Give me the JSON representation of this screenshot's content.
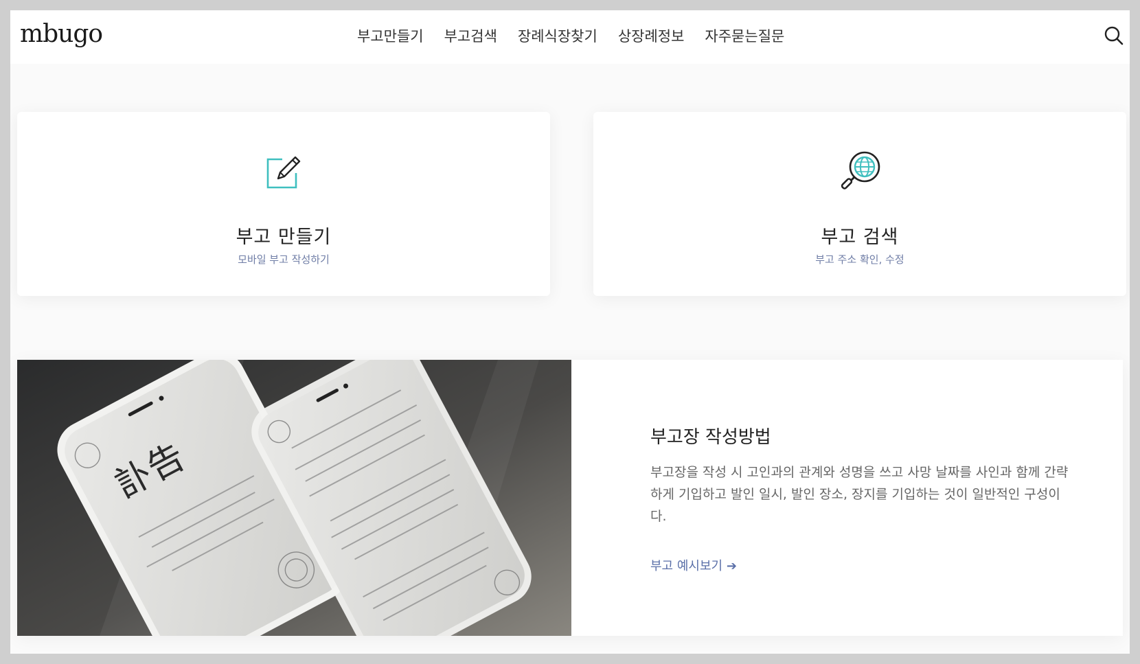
{
  "header": {
    "logo": "mbugo",
    "nav": [
      {
        "label": "부고만들기"
      },
      {
        "label": "부고검색"
      },
      {
        "label": "장례식장찾기"
      },
      {
        "label": "상장례정보"
      },
      {
        "label": "자주묻는질문"
      }
    ],
    "search_icon": "search-icon"
  },
  "cards": [
    {
      "title": "부고 만들기",
      "subtitle": "모바일 부고 작성하기",
      "icon": "edit-icon"
    },
    {
      "title": "부고 검색",
      "subtitle": "부고 주소 확인, 수정",
      "icon": "globe-search-icon"
    }
  ],
  "feature": {
    "title": "부고장 작성방법",
    "description": "부고장을 작성 시 고인과의 관계와 성명을 쓰고 사망 날짜를 사인과 함께 간략하게 기입하고 발인 일시, 발인 장소, 장지를 기입하는 것이 일반적인 구성이다.",
    "link_label": "부고 예시보기",
    "link_arrow": "➔",
    "phone_heading": "訃告"
  },
  "colors": {
    "accent": "#3fbfbf",
    "link": "#5a6fa8"
  }
}
